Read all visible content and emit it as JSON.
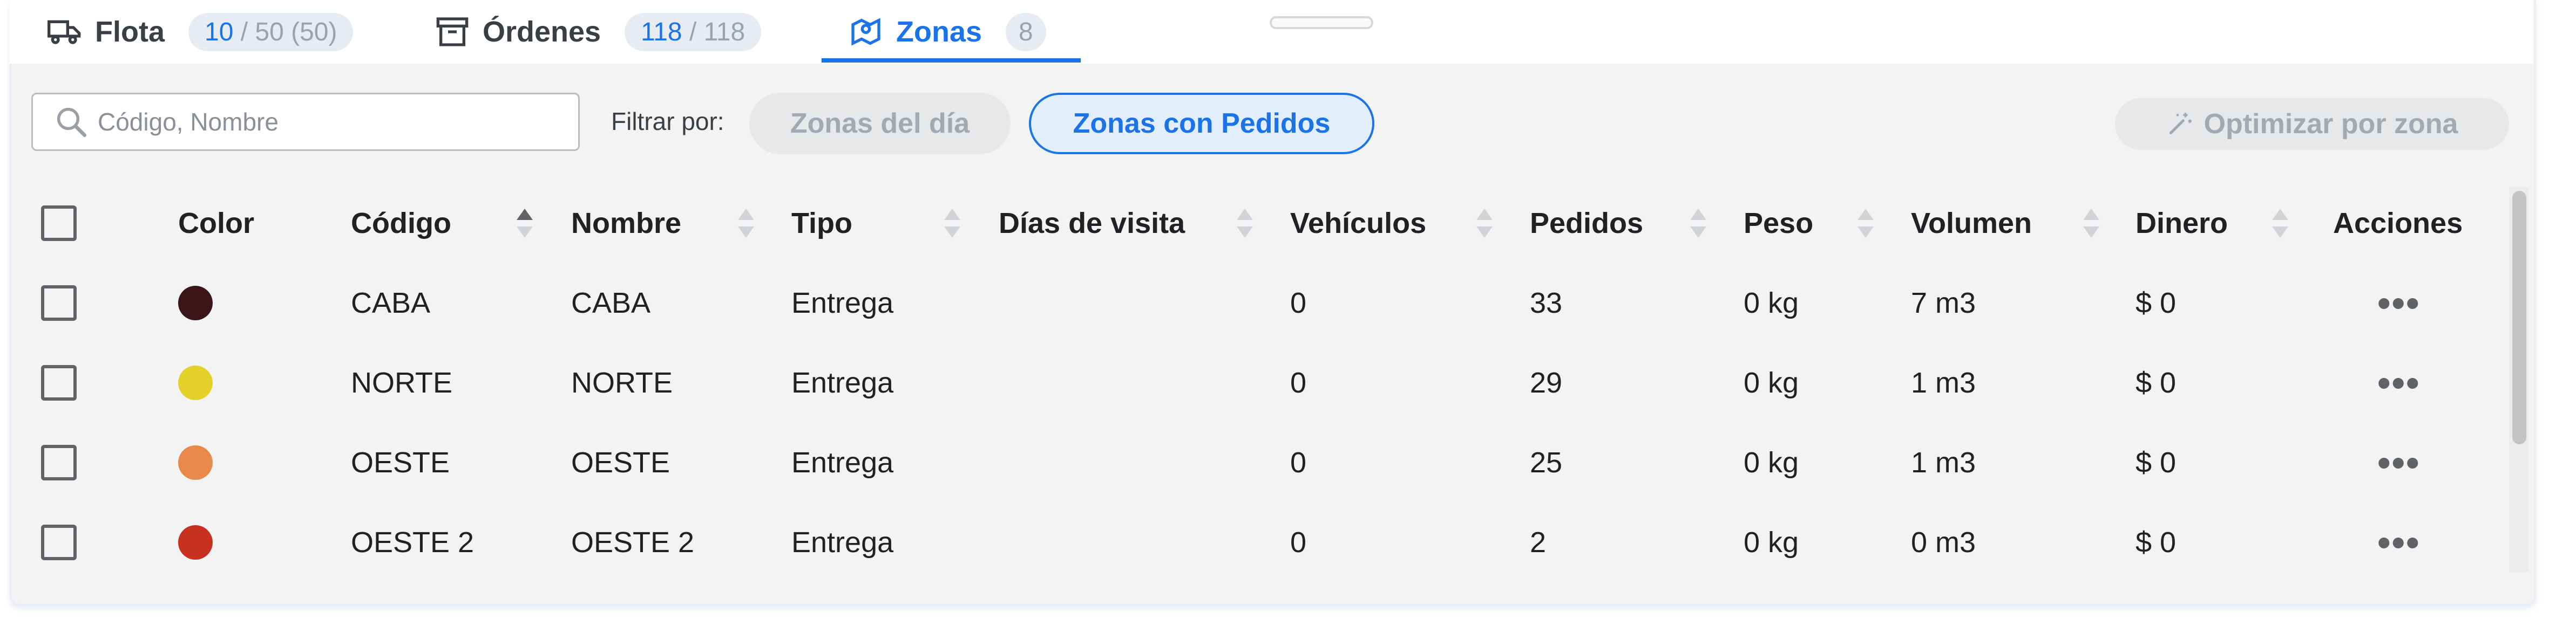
{
  "tabs": [
    {
      "label": "Flota",
      "icon": "truck-icon",
      "count_main": "10",
      "count_rest": " / 50 (50)"
    },
    {
      "label": "Órdenes",
      "icon": "archive-box-icon",
      "count_main": "118",
      "count_rest": " / 118"
    },
    {
      "label": "Zonas",
      "icon": "map-pin-icon",
      "count": "8",
      "active": true
    }
  ],
  "filter": {
    "search_placeholder": "Código, Nombre",
    "search_value": "",
    "label": "Filtrar por:",
    "chip_day": "Zonas del día",
    "chip_orders": "Zonas con Pedidos",
    "optimize_label": "Optimizar por zona"
  },
  "table": {
    "headers": {
      "color": "Color",
      "code": "Código",
      "name": "Nombre",
      "type": "Tipo",
      "days": "Días de visita",
      "vehicles": "Vehículos",
      "orders": "Pedidos",
      "weight": "Peso",
      "volume": "Volumen",
      "money": "Dinero",
      "actions": "Acciones"
    },
    "rows": [
      {
        "color": "#3b1518",
        "code": "CABA",
        "name": "CABA",
        "type": "Entrega",
        "days": "",
        "vehicles": "0",
        "orders": "33",
        "weight": "0 kg",
        "volume": "7 m3",
        "money": "$ 0",
        "actions": "•••"
      },
      {
        "color": "#e3d12a",
        "code": "NORTE",
        "name": "NORTE",
        "type": "Entrega",
        "days": "",
        "vehicles": "0",
        "orders": "29",
        "weight": "0 kg",
        "volume": "1 m3",
        "money": "$ 0",
        "actions": "•••"
      },
      {
        "color": "#e8884a",
        "code": "OESTE",
        "name": "OESTE",
        "type": "Entrega",
        "days": "",
        "vehicles": "0",
        "orders": "25",
        "weight": "0 kg",
        "volume": "1 m3",
        "money": "$ 0",
        "actions": "•••"
      },
      {
        "color": "#c8301f",
        "code": "OESTE 2",
        "name": "OESTE 2",
        "type": "Entrega",
        "days": "",
        "vehicles": "0",
        "orders": "2",
        "weight": "0 kg",
        "volume": "0 m3",
        "money": "$ 0",
        "actions": "•••"
      }
    ]
  },
  "colors": {
    "accent": "#1a73e8",
    "muted": "#a3a9b0"
  }
}
